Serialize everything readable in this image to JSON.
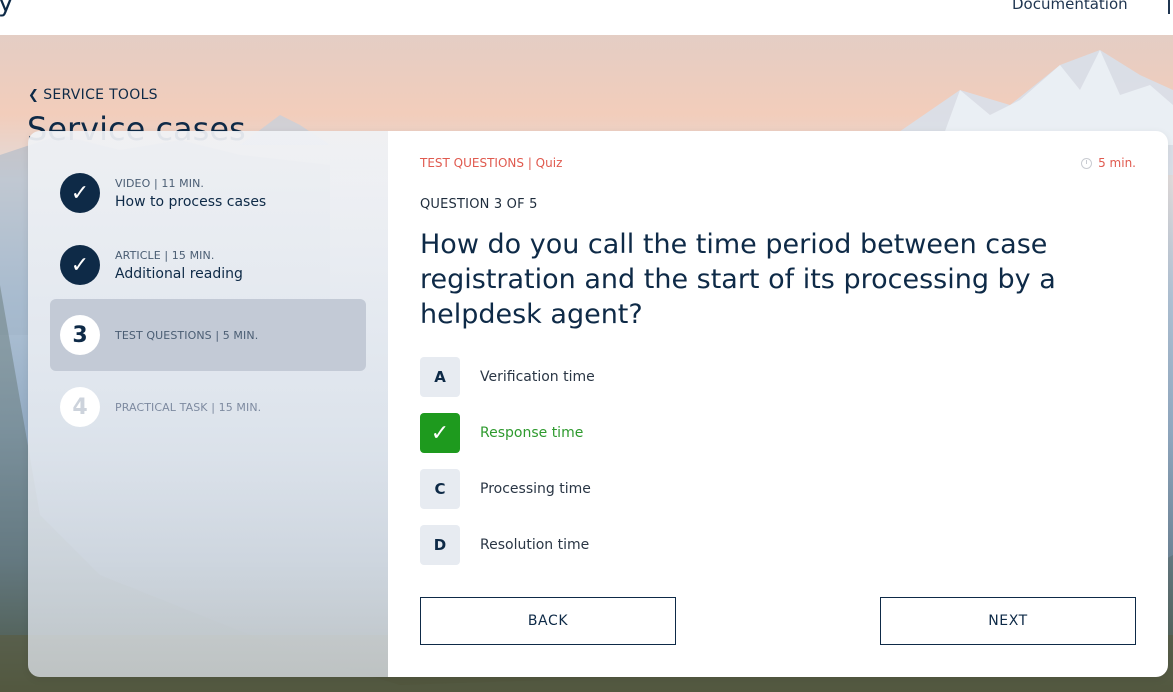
{
  "nav": {
    "brand_fragment": "y",
    "documentation": "Documentation"
  },
  "header": {
    "breadcrumb": "SERVICE TOOLS",
    "title": "Service cases"
  },
  "steps": [
    {
      "meta": "VIDEO | 11 MIN.",
      "title": "How to process cases",
      "state": "done",
      "marker": "✓"
    },
    {
      "meta": "ARTICLE | 15 MIN.",
      "title": "Additional reading",
      "state": "done",
      "marker": "✓"
    },
    {
      "meta": "TEST QUESTIONS | 5 MIN.",
      "title": "",
      "state": "current",
      "marker": "3"
    },
    {
      "meta": "PRACTICAL TASK | 15 MIN.",
      "title": "",
      "state": "todo",
      "marker": "4"
    }
  ],
  "quiz": {
    "section_label": "TEST QUESTIONS | Quiz",
    "time": "5 min.",
    "counter": "QUESTION 3 OF 5",
    "question": "How do you call the time period between case registration and the start of its processing by a helpdesk agent?",
    "answers": [
      {
        "letter": "A",
        "label": "Verification time",
        "selected": false
      },
      {
        "letter": "✓",
        "label": "Response time",
        "selected": true
      },
      {
        "letter": "C",
        "label": "Processing time",
        "selected": false
      },
      {
        "letter": "D",
        "label": "Resolution time",
        "selected": false
      }
    ],
    "back_label": "BACK",
    "next_label": "NEXT"
  },
  "colors": {
    "navy": "#0e2a47",
    "accent_red": "#e05a4f",
    "correct_green": "#1e9a1e"
  }
}
